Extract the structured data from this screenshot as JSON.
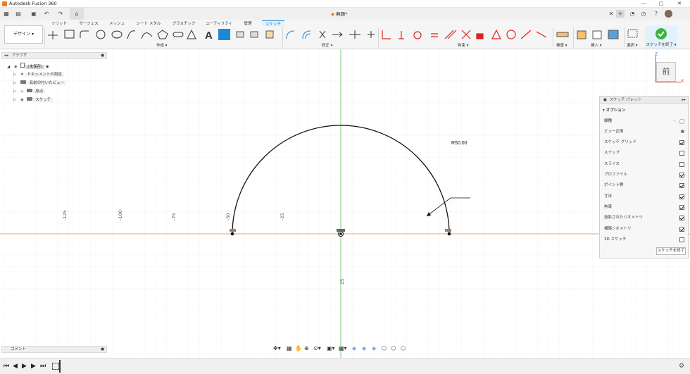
{
  "window": {
    "title": "Autodesk Fusion 360",
    "controls": [
      "—",
      "▢",
      "✕"
    ]
  },
  "document_tab": {
    "title": "無題*"
  },
  "ribbon": {
    "workspace_button": "デザイン ▾",
    "tabs": [
      "ソリッド",
      "サーフェス",
      "メッシュ",
      "シート メタル",
      "プラスチック",
      "ユーティリティ",
      "管理",
      "スケッチ"
    ],
    "active_tab": "スケッチ",
    "groups": [
      "作成 ▾",
      "修正 ▾",
      "拘束 ▾",
      "検査 ▾",
      "挿入 ▾",
      "選択 ▾",
      "スケッチを終了 ▾"
    ]
  },
  "browser": {
    "title": "ブラウザ",
    "root_label": "(未保存)",
    "items": [
      "ドキュメントの設定",
      "名前の付いたビュー",
      "原点",
      "スケッチ"
    ]
  },
  "comments": {
    "title": "コメント"
  },
  "viewcube": {
    "face_label": "前",
    "axis_x": "X",
    "axis_z": "Z"
  },
  "sketch": {
    "dimension_label": "R50.00",
    "axis_ticks": [
      "-125",
      "-100",
      "-75",
      "-50",
      "-25",
      "25"
    ]
  },
  "palette": {
    "title": "スケッチ パレット",
    "section": "オプション",
    "rows": [
      {
        "label": "線種",
        "type": "icons"
      },
      {
        "label": "ビュー正面",
        "type": "icon"
      },
      {
        "label": "スケッチ グリッド",
        "checked": true
      },
      {
        "label": "スナップ",
        "checked": false
      },
      {
        "label": "スライス",
        "checked": false
      },
      {
        "label": "プロファイル",
        "checked": true
      },
      {
        "label": "ポイント群",
        "checked": true
      },
      {
        "label": "寸法",
        "checked": true
      },
      {
        "label": "拘束",
        "checked": true
      },
      {
        "label": "投影されたジオメトリ",
        "checked": true
      },
      {
        "label": "構築ジオメトリ",
        "checked": true
      },
      {
        "label": "3D スケッチ",
        "checked": false
      }
    ],
    "finish_button": "スケッチを終了"
  },
  "colors": {
    "accent": "#1e88d6",
    "finish_green": "#3cb53c",
    "x_axis": "#e8a27a",
    "y_axis": "#7fd07f"
  }
}
